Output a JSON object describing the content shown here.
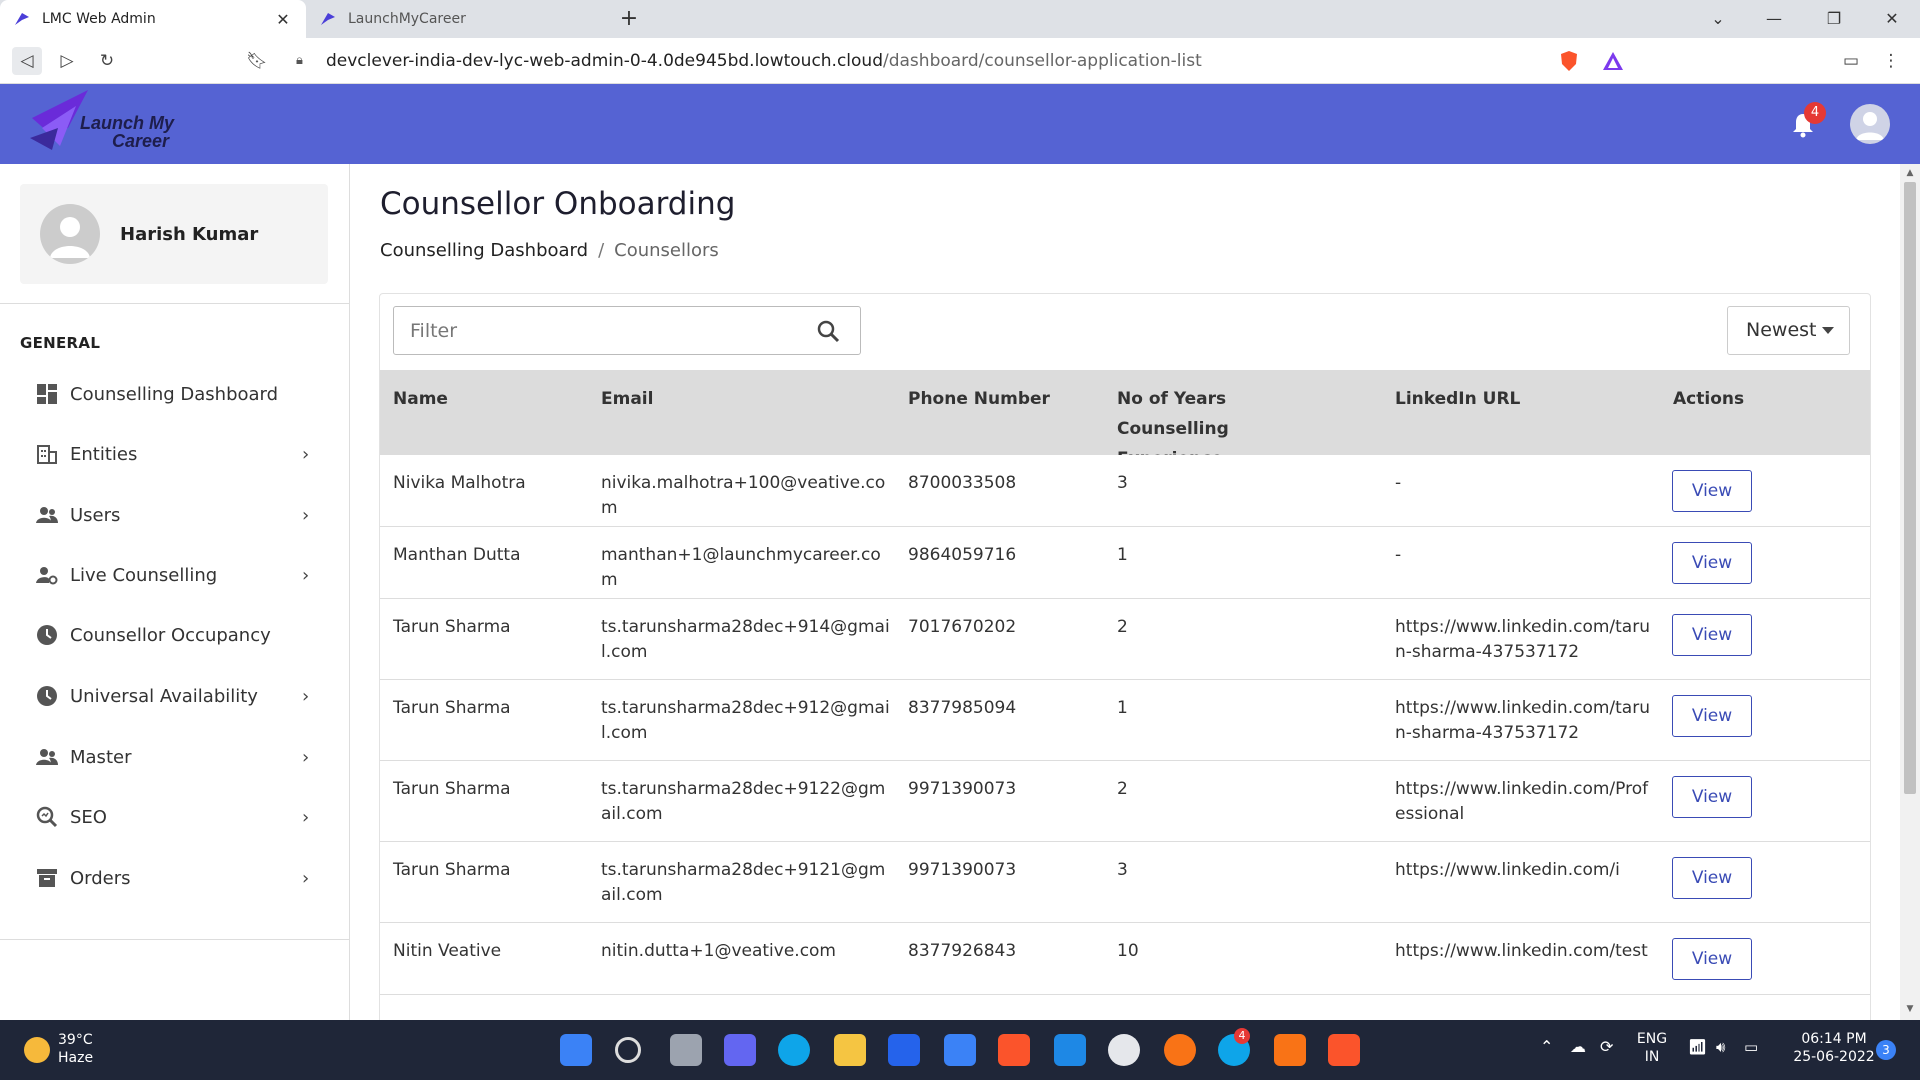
{
  "browser": {
    "tabs": [
      {
        "label": "LMC Web Admin",
        "active": true
      },
      {
        "label": "LaunchMyCareer",
        "active": false
      }
    ],
    "new_tab": "+",
    "url_host": "devclever-india-dev-lyc-web-admin-0-4.0de945bd.lowtouch.cloud",
    "url_path": "/dashboard/counsellor-application-list"
  },
  "app": {
    "logo_line1": "Launch My",
    "logo_line2": "Career",
    "notification_count": "4",
    "header_color": "#5563d3"
  },
  "sidebar": {
    "user_name": "Harish Kumar",
    "section": "GENERAL",
    "items": [
      {
        "label": "Counselling Dashboard",
        "icon": "dashboard-icon",
        "chevron": false
      },
      {
        "label": "Entities",
        "icon": "building-icon",
        "chevron": true
      },
      {
        "label": "Users",
        "icon": "users-icon",
        "chevron": true
      },
      {
        "label": "Live Counselling",
        "icon": "user-gear-icon",
        "chevron": true
      },
      {
        "label": "Counsellor Occupancy",
        "icon": "clock-icon",
        "chevron": false
      },
      {
        "label": "Universal Availability",
        "icon": "clock-icon",
        "chevron": true
      },
      {
        "label": "Master",
        "icon": "users-icon",
        "chevron": true
      },
      {
        "label": "SEO",
        "icon": "seo-search-icon",
        "chevron": true
      },
      {
        "label": "Orders",
        "icon": "orders-icon",
        "chevron": true
      }
    ]
  },
  "page": {
    "title": "Counsellor Onboarding",
    "breadcrumb": [
      "Counselling Dashboard",
      "Counsellors"
    ],
    "breadcrumb_sep": "/",
    "filter_placeholder": "Filter",
    "sort_label": "Newest"
  },
  "table": {
    "columns": [
      "Name",
      "Email",
      "Phone Number",
      "No of Years Counselling Experience",
      "LinkedIn URL",
      "Actions"
    ],
    "action_label": "View",
    "rows": [
      {
        "name": "Nivika Malhotra",
        "email": "nivika.malhotra+100@veative.com",
        "phone": "8700033508",
        "years": "3",
        "linkedin": "-"
      },
      {
        "name": "Manthan Dutta",
        "email": "manthan+1@launchmycareer.com",
        "phone": "9864059716",
        "years": "1",
        "linkedin": "-"
      },
      {
        "name": "Tarun Sharma",
        "email": "ts.tarunsharma28dec+914@gmail.com",
        "phone": "7017670202",
        "years": "2",
        "linkedin": "https://www.linkedin.com/tarun-sharma-437537172"
      },
      {
        "name": "Tarun Sharma",
        "email": "ts.tarunsharma28dec+912@gmail.com",
        "phone": "8377985094",
        "years": "1",
        "linkedin": "https://www.linkedin.com/tarun-sharma-437537172"
      },
      {
        "name": "Tarun Sharma",
        "email": "ts.tarunsharma28dec+9122@gmail.com",
        "phone": "9971390073",
        "years": "2",
        "linkedin": "https://www.linkedin.com/Professional"
      },
      {
        "name": "Tarun Sharma",
        "email": "ts.tarunsharma28dec+9121@gmail.com",
        "phone": "9971390073",
        "years": "3",
        "linkedin": "https://www.linkedin.com/i"
      },
      {
        "name": "Nitin Veative",
        "email": "nitin.dutta+1@veative.com",
        "phone": "8377926843",
        "years": "10",
        "linkedin": "https://www.linkedin.com/test"
      }
    ]
  },
  "taskbar": {
    "temperature": "39°C",
    "weather": "Haze",
    "lang_line1": "ENG",
    "lang_line2": "IN",
    "time": "06:14 PM",
    "date": "25-06-2022",
    "notif_count": "3",
    "slack_badge": "4"
  }
}
